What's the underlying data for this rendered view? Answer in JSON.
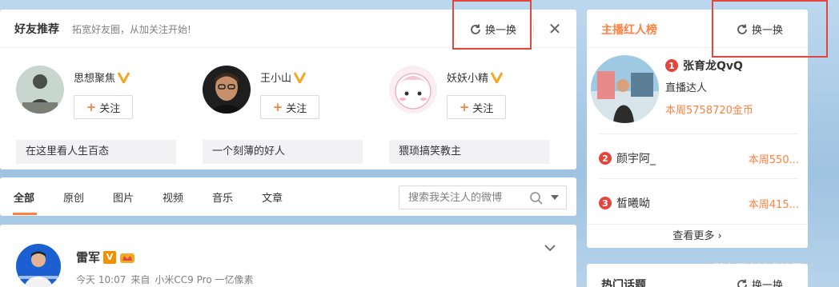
{
  "friend_recommend": {
    "title": "好友推荐",
    "subtitle": "拓宽好友圈，从加关注开始!",
    "refresh_label": "换一换",
    "close_glyph": "✕",
    "friends": [
      {
        "name": "思想聚焦",
        "follow_label": "关注",
        "desc": "在这里看人生百态"
      },
      {
        "name": "王小山",
        "follow_label": "关注",
        "desc": "一个刻薄的好人"
      },
      {
        "name": "妖妖小精",
        "follow_label": "关注",
        "desc": "猥琐搞笑教主"
      }
    ]
  },
  "feed_tabs": {
    "tabs": [
      "全部",
      "原创",
      "图片",
      "视频",
      "音乐",
      "文章"
    ],
    "active": "全部",
    "search_placeholder": "搜索我关注人的微博"
  },
  "post": {
    "author": "雷军",
    "vip_badge": "V",
    "time": "今天 10:07",
    "source_prefix": "来自",
    "source": "小米CC9 Pro 一亿像素"
  },
  "anchor_rank": {
    "title": "主播红人榜",
    "refresh_label": "换一换",
    "top1": {
      "rank": "1",
      "name": "张育龙QvQ",
      "role": "直播达人",
      "coins": "本周5758720金币"
    },
    "rows": [
      {
        "rank": "2",
        "name": "颜宇阿_",
        "score": "本周550..."
      },
      {
        "rank": "3",
        "name": "皙曦呦",
        "score": "本周415..."
      }
    ],
    "more_label": "查看更多 ›"
  },
  "hot_topics": {
    "title": "热门话题",
    "refresh_label": "换一换"
  },
  "watermark": "@稀土掘金技术社区",
  "colors": {
    "accent": "#ff8140",
    "highlight_box": "#e2463e",
    "badge_gold": "#f5a623"
  }
}
